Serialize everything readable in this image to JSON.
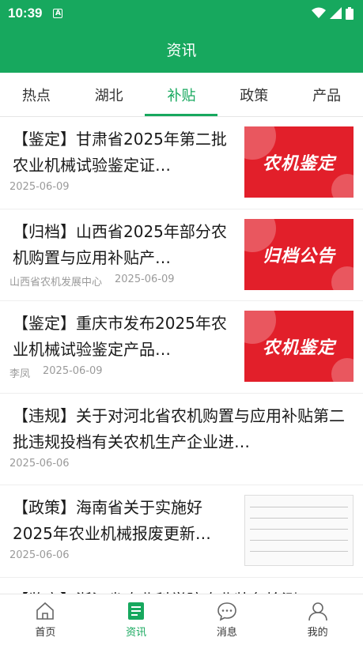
{
  "status": {
    "time": "10:39",
    "notif_letter": "A"
  },
  "app_title": "资讯",
  "tabs": [
    "热点",
    "湖北",
    "补贴",
    "政策",
    "产品"
  ],
  "active_tab": 2,
  "articles": [
    {
      "title": "【鉴定】甘肃省2025年第二批农业机械试验鉴定证…",
      "source": "",
      "date": "2025-06-09",
      "thumb_text": "农机鉴定",
      "thumb_style": "red"
    },
    {
      "title": "【归档】山西省2025年部分农机购置与应用补贴产…",
      "source": "山西省农机发展中心",
      "date": "2025-06-09",
      "thumb_text": "归档公告",
      "thumb_style": "red"
    },
    {
      "title": "【鉴定】重庆市发布2025年农业机械试验鉴定产品…",
      "source": "李凤",
      "date": "2025-06-09",
      "thumb_text": "农机鉴定",
      "thumb_style": "red"
    },
    {
      "title": "【违规】关于对河北省农机购置与应用补贴第二批违规投档有关农机生产企业进…",
      "source": "",
      "date": "2025-06-06",
      "thumb_text": "",
      "thumb_style": "none"
    },
    {
      "title": "【政策】海南省关于实施好2025年农业机械报废更新…",
      "source": "",
      "date": "2025-06-06",
      "thumb_text": "",
      "thumb_style": "doc"
    },
    {
      "title": "【监定】浙江省农业科学院农业装备检测…",
      "source": "",
      "date": "",
      "thumb_text": "",
      "thumb_style": "none"
    }
  ],
  "bottom_nav": [
    {
      "label": "首页",
      "icon": "home-icon"
    },
    {
      "label": "资讯",
      "icon": "news-icon"
    },
    {
      "label": "消息",
      "icon": "message-icon"
    },
    {
      "label": "我的",
      "icon": "profile-icon"
    }
  ],
  "active_nav": 1,
  "colors": {
    "brand": "#17a85e",
    "thumb_red": "#e21f2a"
  }
}
